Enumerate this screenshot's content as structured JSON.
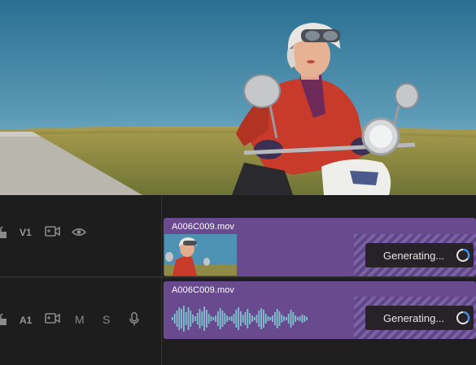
{
  "timeline": {
    "video_track": {
      "label": "V1",
      "clip_name": "A006C009.mov",
      "status": "Generating..."
    },
    "audio_track": {
      "label": "A1",
      "mute_letter": "M",
      "solo_letter": "S",
      "clip_name": "A006C009.mov",
      "status": "Generating..."
    }
  },
  "colors": {
    "clip": "#6a4a8e",
    "hatch_light": "#7b62a6",
    "waveform": "#7dc4cf",
    "spinner": "#3b8fe8"
  },
  "icons": [
    "lock-icon",
    "camera-icon",
    "eye-icon",
    "microphone-icon",
    "spinner-icon"
  ]
}
